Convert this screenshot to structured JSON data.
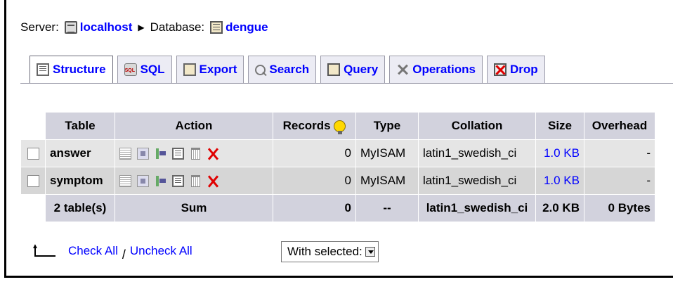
{
  "breadcrumb": {
    "server_label": "Server:",
    "server_name": "localhost",
    "database_label": "Database:",
    "database_name": "dengue"
  },
  "tabs": [
    {
      "label": "Structure",
      "icon": "structure-icon",
      "active": true
    },
    {
      "label": "SQL",
      "icon": "sql-icon"
    },
    {
      "label": "Export",
      "icon": "export-icon"
    },
    {
      "label": "Search",
      "icon": "search-icon"
    },
    {
      "label": "Query",
      "icon": "query-icon"
    },
    {
      "label": "Operations",
      "icon": "operations-icon"
    },
    {
      "label": "Drop",
      "icon": "drop-icon"
    }
  ],
  "table": {
    "headers": {
      "table": "Table",
      "action": "Action",
      "records": "Records",
      "type": "Type",
      "collation": "Collation",
      "size": "Size",
      "overhead": "Overhead"
    },
    "rows": [
      {
        "name": "answer",
        "records": "0",
        "type": "MyISAM",
        "collation": "latin1_swedish_ci",
        "size": "1.0 KB",
        "overhead": "-"
      },
      {
        "name": "symptom",
        "records": "0",
        "type": "MyISAM",
        "collation": "latin1_swedish_ci",
        "size": "1.0 KB",
        "overhead": "-"
      }
    ],
    "footer": {
      "count": "2 table(s)",
      "sum_label": "Sum",
      "records": "0",
      "type": "--",
      "collation": "latin1_swedish_ci",
      "size": "2.0 KB",
      "overhead": "0 Bytes"
    }
  },
  "bottom": {
    "check_all": "Check All",
    "separator": "/",
    "uncheck_all": "Uncheck All",
    "with_selected": "With selected:"
  },
  "colors": {
    "link": "#0000ff",
    "header_bg": "#d2d2dd",
    "row_odd": "#e5e5e5",
    "row_even": "#d6d6d6",
    "drop_red": "#e00000"
  }
}
